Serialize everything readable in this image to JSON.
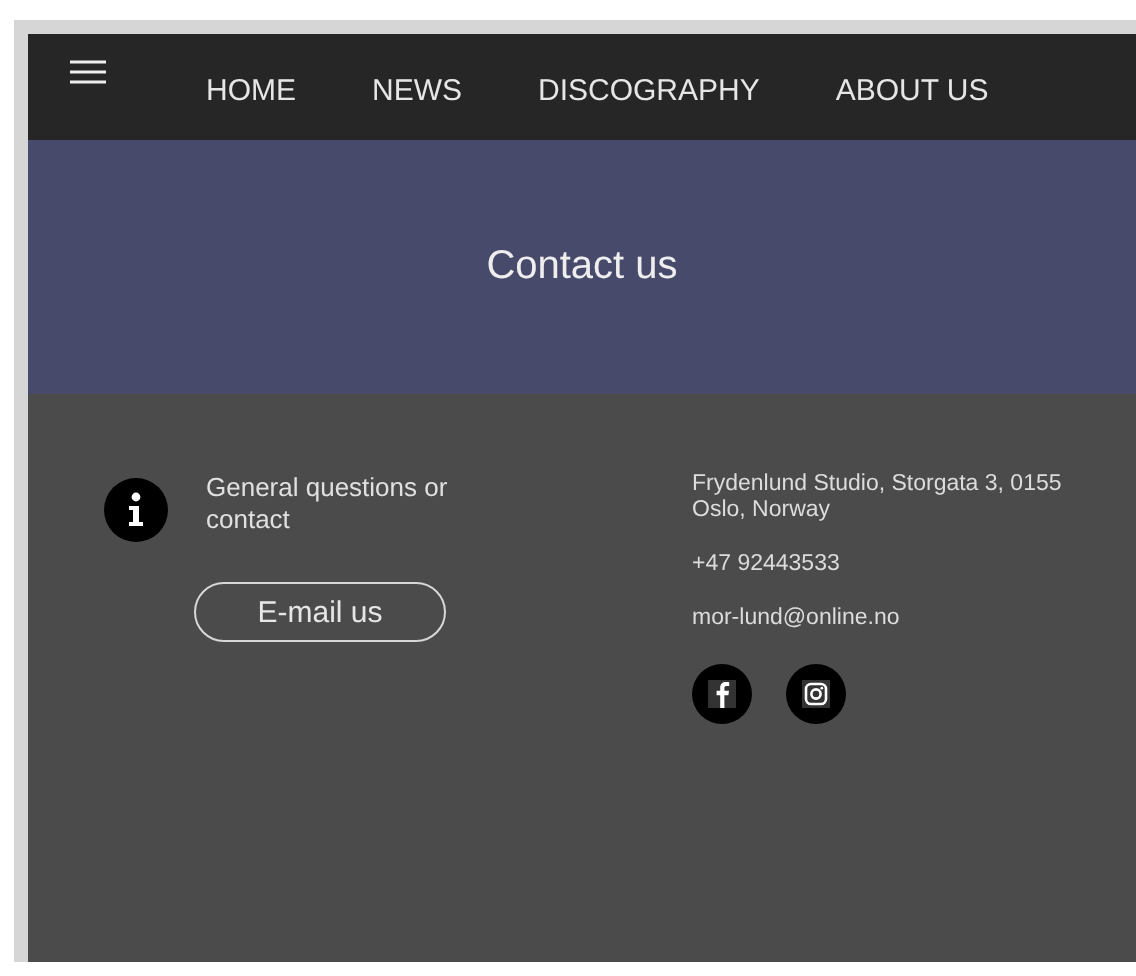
{
  "nav": {
    "items": [
      {
        "label": "HOME"
      },
      {
        "label": "NEWS"
      },
      {
        "label": "DISCOGRAPHY"
      },
      {
        "label": "ABOUT US"
      }
    ]
  },
  "banner": {
    "title": "Contact us"
  },
  "contact": {
    "general": {
      "text": "General questions or contact",
      "button": "E-mail us"
    },
    "address": "Frydenlund Studio, Storgata 3, 0155 Oslo, Norway",
    "phone": "+47 92443533",
    "email": "mor-lund@online.no",
    "social": [
      {
        "kind": "facebook"
      },
      {
        "kind": "instagram"
      }
    ]
  }
}
